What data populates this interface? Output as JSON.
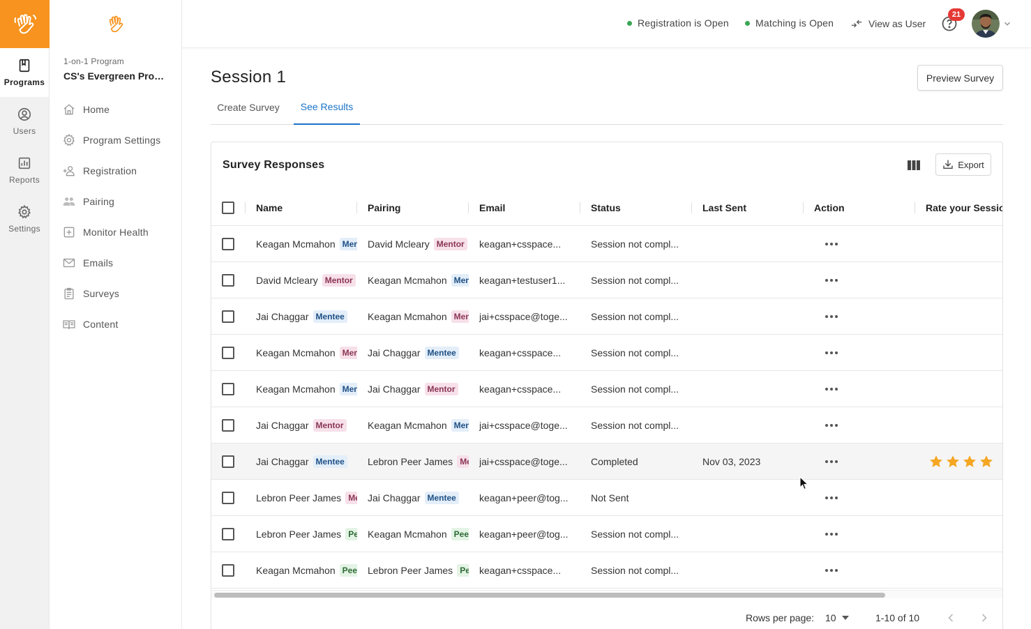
{
  "rail": {
    "items": [
      {
        "label": "Programs",
        "icon": "book-icon"
      },
      {
        "label": "Users",
        "icon": "user-circle-icon"
      },
      {
        "label": "Reports",
        "icon": "chart-icon"
      },
      {
        "label": "Settings",
        "icon": "gear-icon"
      }
    ]
  },
  "sidebar": {
    "program_type": "1-on-1 Program",
    "program_name": "CS's Evergreen Prog...",
    "items": [
      {
        "label": "Home"
      },
      {
        "label": "Program Settings"
      },
      {
        "label": "Registration"
      },
      {
        "label": "Pairing"
      },
      {
        "label": "Monitor Health"
      },
      {
        "label": "Emails"
      },
      {
        "label": "Surveys"
      },
      {
        "label": "Content"
      }
    ]
  },
  "topbar": {
    "registration": "Registration is Open",
    "matching": "Matching is Open",
    "view_as": "View as User",
    "notifications": "21"
  },
  "page": {
    "title": "Session 1",
    "preview_button": "Preview Survey",
    "tabs": [
      "Create Survey",
      "See Results"
    ],
    "active_tab": "See Results"
  },
  "card": {
    "title": "Survey Responses",
    "export": "Export"
  },
  "table": {
    "columns": [
      "Name",
      "Pairing",
      "Email",
      "Status",
      "Last Sent",
      "Action",
      "Rate your Session"
    ],
    "rows": [
      {
        "name": "Keagan Mcmahon",
        "name_tag": "Mentee",
        "name_tag_type": "mentee",
        "pairing": "David Mcleary",
        "pairing_tag": "Mentor",
        "pairing_tag_type": "mentor",
        "email": "keagan+csspace...",
        "status": "Session not compl...",
        "last_sent": "",
        "rating": 0
      },
      {
        "name": "David Mcleary",
        "name_tag": "Mentor",
        "name_tag_type": "mentor",
        "pairing": "Keagan Mcmahon",
        "pairing_tag": "Mentee",
        "pairing_tag_type": "mentee",
        "email": "keagan+testuser1...",
        "status": "Session not compl...",
        "last_sent": "",
        "rating": 0
      },
      {
        "name": "Jai Chaggar",
        "name_tag": "Mentee",
        "name_tag_type": "mentee",
        "pairing": "Keagan Mcmahon",
        "pairing_tag": "Mentor",
        "pairing_tag_type": "mentor",
        "email": "jai+csspace@toge...",
        "status": "Session not compl...",
        "last_sent": "",
        "rating": 0
      },
      {
        "name": "Keagan Mcmahon",
        "name_tag": "Mentor",
        "name_tag_type": "mentor",
        "pairing": "Jai Chaggar",
        "pairing_tag": "Mentee",
        "pairing_tag_type": "mentee",
        "email": "keagan+csspace...",
        "status": "Session not compl...",
        "last_sent": "",
        "rating": 0
      },
      {
        "name": "Keagan Mcmahon",
        "name_tag": "Mentee",
        "name_tag_type": "mentee",
        "pairing": "Jai Chaggar",
        "pairing_tag": "Mentor",
        "pairing_tag_type": "mentor",
        "email": "keagan+csspace...",
        "status": "Session not compl...",
        "last_sent": "",
        "rating": 0
      },
      {
        "name": "Jai Chaggar",
        "name_tag": "Mentor",
        "name_tag_type": "mentor",
        "pairing": "Keagan Mcmahon",
        "pairing_tag": "Mentee",
        "pairing_tag_type": "mentee",
        "email": "jai+csspace@toge...",
        "status": "Session not compl...",
        "last_sent": "",
        "rating": 0
      },
      {
        "name": "Jai Chaggar",
        "name_tag": "Mentee",
        "name_tag_type": "mentee",
        "pairing": "Lebron Peer James",
        "pairing_tag": "Mentor",
        "pairing_tag_type": "mentor",
        "email": "jai+csspace@toge...",
        "status": "Completed",
        "last_sent": "Nov 03, 2023",
        "rating": 4
      },
      {
        "name": "Lebron Peer James",
        "name_tag": "Mentor",
        "name_tag_type": "mentor",
        "pairing": "Jai Chaggar",
        "pairing_tag": "Mentee",
        "pairing_tag_type": "mentee",
        "email": "keagan+peer@tog...",
        "status": "Not Sent",
        "last_sent": "",
        "rating": 0
      },
      {
        "name": "Lebron Peer James",
        "name_tag": "Peer",
        "name_tag_type": "peer",
        "pairing": "Keagan Mcmahon",
        "pairing_tag": "Peer",
        "pairing_tag_type": "peer",
        "email": "keagan+peer@tog...",
        "status": "Session not compl...",
        "last_sent": "",
        "rating": 0
      },
      {
        "name": "Keagan Mcmahon",
        "name_tag": "Peer",
        "name_tag_type": "peer",
        "pairing": "Lebron Peer James",
        "pairing_tag": "Peer",
        "pairing_tag_type": "peer",
        "email": "keagan+csspace...",
        "status": "Session not compl...",
        "last_sent": "",
        "rating": 0
      }
    ]
  },
  "footer": {
    "rows_per_page_label": "Rows per page:",
    "rows_per_page": "10",
    "range": "1-10 of 10"
  },
  "colors": {
    "brand": "#f7931e",
    "accent": "#1a73c8",
    "status_green": "#3aa655",
    "star": "#f5a623"
  }
}
